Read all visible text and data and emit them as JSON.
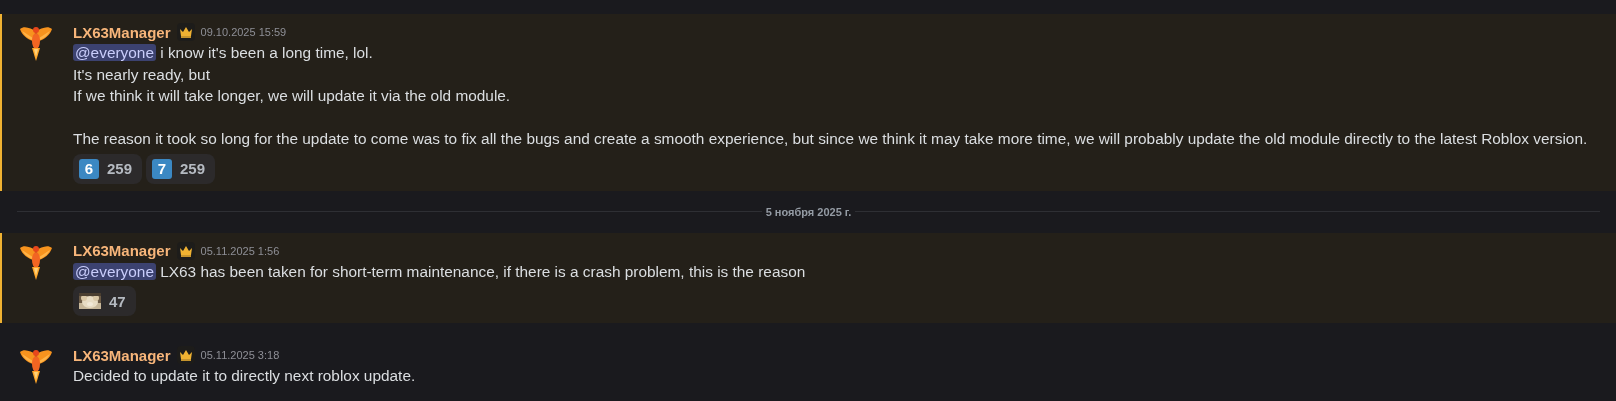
{
  "items": [
    {
      "kind": "message",
      "author": "LX63Manager",
      "owner": true,
      "timestamp": "09.10.2025 15:59",
      "highlighted": true,
      "paragraphs": [
        [
          {
            "mention": "@everyone",
            "text": "i know it's been a long time, lol."
          },
          {
            "text": "It's nearly ready, but"
          },
          {
            "text": "If we think it will take longer, we will update it via the old module."
          }
        ],
        [
          {
            "text": "The reason it took so long for the update to come was to fix all the bugs and create a smooth experience, but since we think it may take more time, we will probably update the old module directly to the latest Roblox version."
          }
        ]
      ],
      "reactions": [
        {
          "kind": "keycap",
          "label": "6",
          "count": "259"
        },
        {
          "kind": "keycap",
          "label": "7",
          "count": "259"
        }
      ]
    },
    {
      "kind": "divider",
      "label": "5 ноября 2025 г."
    },
    {
      "kind": "message",
      "author": "LX63Manager",
      "owner": true,
      "timestamp": "05.11.2025 1:56",
      "highlighted": true,
      "paragraphs": [
        [
          {
            "mention": "@everyone",
            "text": "LX63 has been taken for short-term maintenance, if there is a crash problem, this is the reason"
          }
        ]
      ],
      "reactions": [
        {
          "kind": "picture",
          "count": "47"
        }
      ]
    },
    {
      "kind": "message",
      "author": "LX63Manager",
      "owner": true,
      "timestamp": "05.11.2025 3:18",
      "highlighted": false,
      "paragraphs": [
        [
          {
            "text": "Decided to update it to directly next roblox update."
          }
        ]
      ]
    }
  ]
}
